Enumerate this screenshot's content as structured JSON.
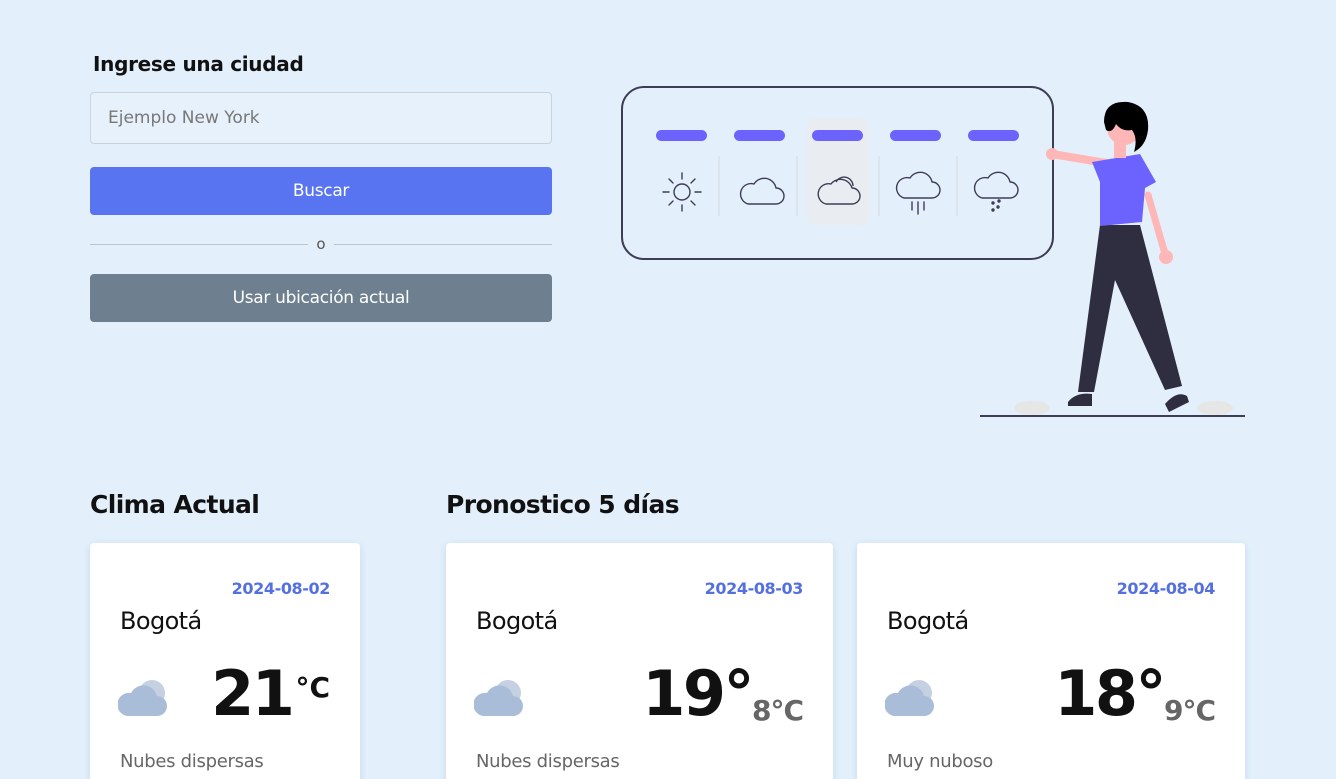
{
  "search": {
    "label": "Ingrese una ciudad",
    "placeholder": "Ejemplo New York",
    "value": "",
    "button_label": "Buscar",
    "or_label": "o",
    "location_button_label": "Usar ubicación actual"
  },
  "sections": {
    "current_title": "Clima Actual",
    "forecast_title": "Pronostico 5 días"
  },
  "current": {
    "date": "2024-08-02",
    "city": "Bogotá",
    "temp": "21",
    "unit": "°C",
    "description": "Nubes dispersas",
    "icon": "partly-cloudy-icon"
  },
  "forecast": [
    {
      "date": "2024-08-03",
      "city": "Bogotá",
      "temp_max": "19°",
      "temp_min": "8°C",
      "description": "Nubes dispersas",
      "icon": "partly-cloudy-icon"
    },
    {
      "date": "2024-08-04",
      "city": "Bogotá",
      "temp_max": "18°",
      "temp_min": "9°C",
      "description": "Muy nuboso",
      "icon": "partly-cloudy-icon"
    }
  ],
  "hero": {
    "icons": [
      "sun-icon",
      "cloud-icon",
      "partly-cloudy-icon",
      "rain-icon",
      "snow-icon"
    ],
    "selected_index": 2
  },
  "colors": {
    "background": "#e3f0fc",
    "primary": "#5874f0",
    "secondary": "#6e7f90",
    "accent": "#6c63ff",
    "date": "#5470e0"
  }
}
